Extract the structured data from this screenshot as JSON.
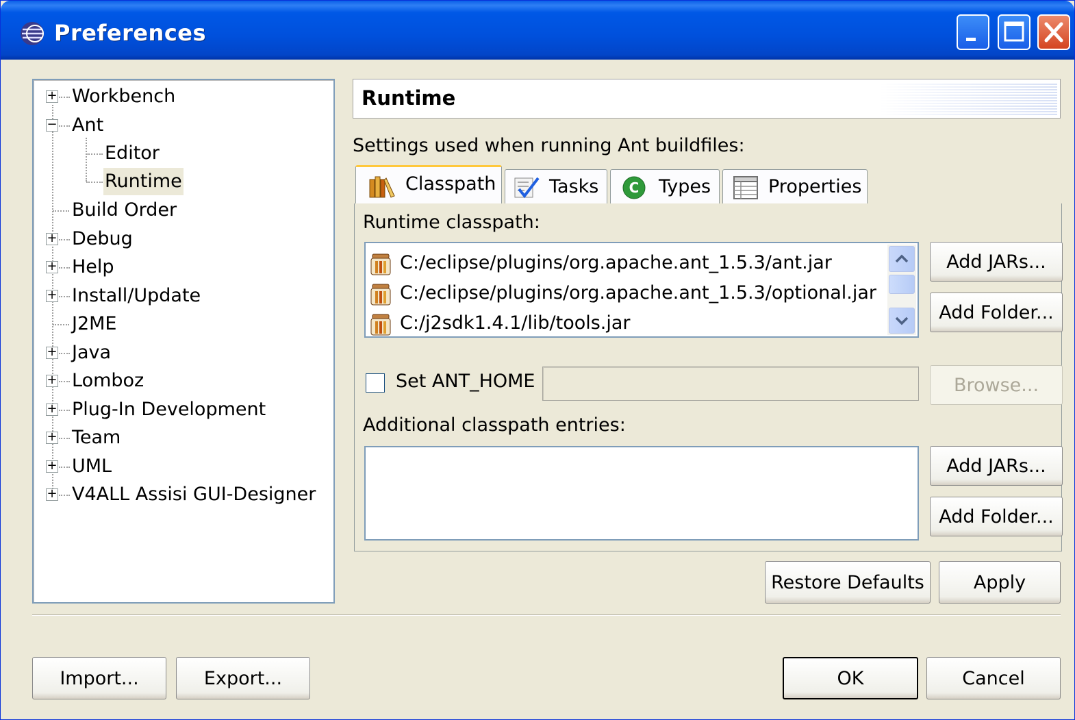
{
  "window": {
    "title": "Preferences"
  },
  "tree": {
    "items": [
      {
        "label": "Workbench",
        "expander": "+"
      },
      {
        "label": "Ant",
        "expander": "−"
      },
      {
        "label": "Editor",
        "expander": ""
      },
      {
        "label": "Runtime",
        "expander": "",
        "selected": true
      },
      {
        "label": "Build Order",
        "expander": ""
      },
      {
        "label": "Debug",
        "expander": "+"
      },
      {
        "label": "Help",
        "expander": "+"
      },
      {
        "label": "Install/Update",
        "expander": "+"
      },
      {
        "label": "J2ME",
        "expander": ""
      },
      {
        "label": "Java",
        "expander": "+"
      },
      {
        "label": "Lomboz",
        "expander": "+"
      },
      {
        "label": "Plug-In Development",
        "expander": "+"
      },
      {
        "label": "Team",
        "expander": "+"
      },
      {
        "label": "UML",
        "expander": "+"
      },
      {
        "label": "V4ALL Assisi GUI-Designer",
        "expander": "+"
      }
    ]
  },
  "page": {
    "title": "Runtime",
    "description": "Settings used when running Ant buildfiles:"
  },
  "tabs": [
    {
      "label": "Classpath",
      "icon": "books-icon"
    },
    {
      "label": "Tasks",
      "icon": "tasks-icon"
    },
    {
      "label": "Types",
      "icon": "types-c-icon"
    },
    {
      "label": "Properties",
      "icon": "properties-table-icon"
    }
  ],
  "classpath": {
    "runtime_label": "Runtime classpath:",
    "runtime_entries": [
      "C:/eclipse/plugins/org.apache.ant_1.5.3/ant.jar",
      "C:/eclipse/plugins/org.apache.ant_1.5.3/optional.jar",
      "C:/j2sdk1.4.1/lib/tools.jar"
    ],
    "add_jars_label": "Add JARs...",
    "add_folder_label": "Add Folder...",
    "ant_home_label": "Set ANT_HOME",
    "ant_home_value": "",
    "browse_label": "Browse...",
    "additional_label": "Additional classpath entries:",
    "additional_add_jars_label": "Add JARs...",
    "additional_add_folder_label": "Add Folder..."
  },
  "actions": {
    "restore_defaults": "Restore Defaults",
    "apply": "Apply",
    "import": "Import...",
    "export": "Export...",
    "ok": "OK",
    "cancel": "Cancel"
  }
}
